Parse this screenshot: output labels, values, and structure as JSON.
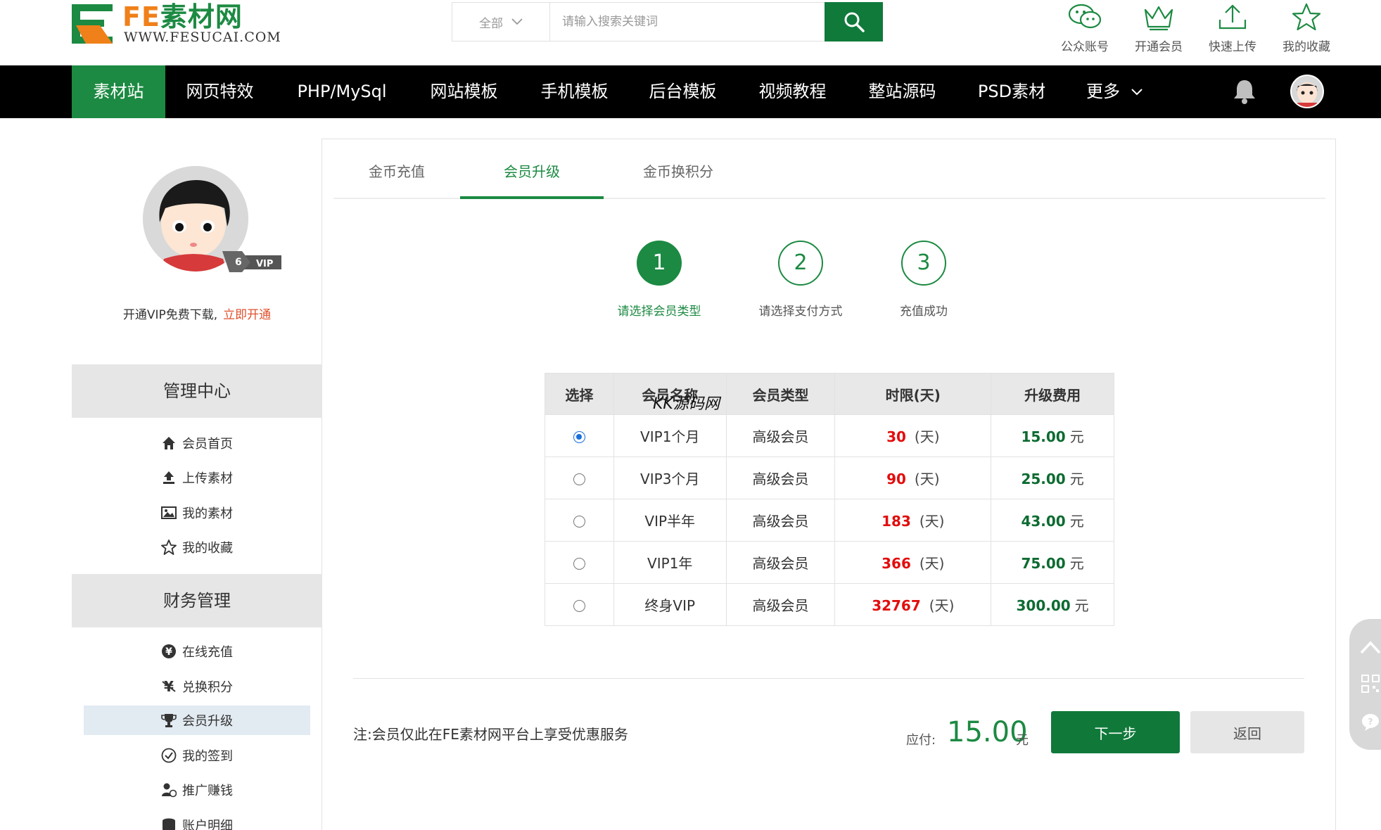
{
  "logo": {
    "mark": "FE",
    "title": "素材网",
    "url_text": "WWW.FESUCAI.COM"
  },
  "search": {
    "category": "全部",
    "placeholder": "请输入搜索关键词",
    "button_icon": "search-icon"
  },
  "quick_links": [
    {
      "label": "公众账号",
      "icon": "wechat-icon"
    },
    {
      "label": "开通会员",
      "icon": "crown-icon"
    },
    {
      "label": "快速上传",
      "icon": "upload-icon"
    },
    {
      "label": "我的收藏",
      "icon": "star-icon"
    }
  ],
  "nav": {
    "items": [
      "素材站",
      "网页特效",
      "PHP/MySql",
      "网站模板",
      "手机模板",
      "后台模板",
      "视频教程",
      "整站源码",
      "PSD素材",
      "更多"
    ],
    "active_index": 0,
    "icons": [
      "bell-icon",
      "avatar"
    ]
  },
  "sidebar": {
    "vip_badge": "VIP",
    "tip_text": "开通VIP免费下载,",
    "tip_link": "立即开通",
    "section_manage": "管理中心",
    "manage_items": [
      {
        "label": "会员首页",
        "icon": "home-icon"
      },
      {
        "label": "上传素材",
        "icon": "upload-icon"
      },
      {
        "label": "我的素材",
        "icon": "image-icon"
      },
      {
        "label": "我的收藏",
        "icon": "star-icon"
      }
    ],
    "section_finance": "财务管理",
    "finance_items": [
      {
        "label": "在线充值",
        "icon": "yen-icon"
      },
      {
        "label": "兑换积分",
        "icon": "exchange-icon"
      },
      {
        "label": "会员升级",
        "icon": "trophy-icon",
        "active": true
      },
      {
        "label": "我的签到",
        "icon": "check-circle-icon"
      },
      {
        "label": "推广赚钱",
        "icon": "user-coin-icon"
      },
      {
        "label": "账户明细",
        "icon": "database-icon"
      }
    ]
  },
  "tabs": [
    {
      "label": "金币充值"
    },
    {
      "label": "会员升级",
      "active": true
    },
    {
      "label": "金币换积分"
    }
  ],
  "steps": [
    {
      "num": "1",
      "label": "请选择会员类型",
      "active": true
    },
    {
      "num": "2",
      "label": "请选择支付方式"
    },
    {
      "num": "3",
      "label": "充值成功"
    }
  ],
  "table": {
    "headers": [
      "选择",
      "会员名称",
      "会员类型",
      "时限(天)",
      "升级费用"
    ],
    "rows": [
      {
        "selected": true,
        "name": "VIP1个月",
        "type": "高级会员",
        "days": "30",
        "day_unit": "(天)",
        "fee": "15.00",
        "fee_unit": "元"
      },
      {
        "selected": false,
        "name": "VIP3个月",
        "type": "高级会员",
        "days": "90",
        "day_unit": "(天)",
        "fee": "25.00",
        "fee_unit": "元"
      },
      {
        "selected": false,
        "name": "VIP半年",
        "type": "高级会员",
        "days": "183",
        "day_unit": "(天)",
        "fee": "43.00",
        "fee_unit": "元"
      },
      {
        "selected": false,
        "name": "VIP1年",
        "type": "高级会员",
        "days": "366",
        "day_unit": "(天)",
        "fee": "75.00",
        "fee_unit": "元"
      },
      {
        "selected": false,
        "name": "终身VIP",
        "type": "高级会员",
        "days": "32767",
        "day_unit": "(天)",
        "fee": "300.00",
        "fee_unit": "元"
      }
    ]
  },
  "watermark": "KK源码网",
  "footer": {
    "note": "注:会员仅此在FE素材网平台上享受优惠服务",
    "pay_label": "应付:",
    "pay_amount": "15.00",
    "pay_unit": "元",
    "next_label": "下一步",
    "back_label": "返回"
  },
  "colors": {
    "brand_green": "#1c8a42",
    "nav_black": "#000000",
    "accent_orange": "#f08019",
    "red_days": "#e30d0d"
  }
}
